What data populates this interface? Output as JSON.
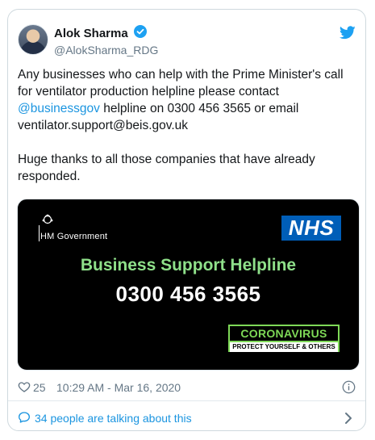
{
  "author": {
    "name": "Alok Sharma",
    "handle": "@AlokSharma_RDG"
  },
  "tweet": {
    "line1_before": "Any businesses who can help with the Prime Minister's call for ventilator production helpline please contact ",
    "mention": "@businessgov",
    "line1_after": " helpline on 0300 456 3565 or email ventilator.support@beis.gov.uk",
    "line2": "Huge thanks to all those companies that have already responded."
  },
  "media": {
    "org": "HM Government",
    "nhs": "NHS",
    "title": "Business Support Helpline",
    "phone": "0300 456 3565",
    "badge_title": "CORONAVIRUS",
    "badge_sub": "PROTECT YOURSELF & OTHERS"
  },
  "meta": {
    "likes": "25",
    "timestamp": "10:29 AM - Mar 16, 2020"
  },
  "footer": {
    "talking": "34 people are talking about this"
  },
  "colors": {
    "link": "#1b95e0",
    "nhs_blue": "#005eb8",
    "helpline_green": "#8fe08a"
  }
}
